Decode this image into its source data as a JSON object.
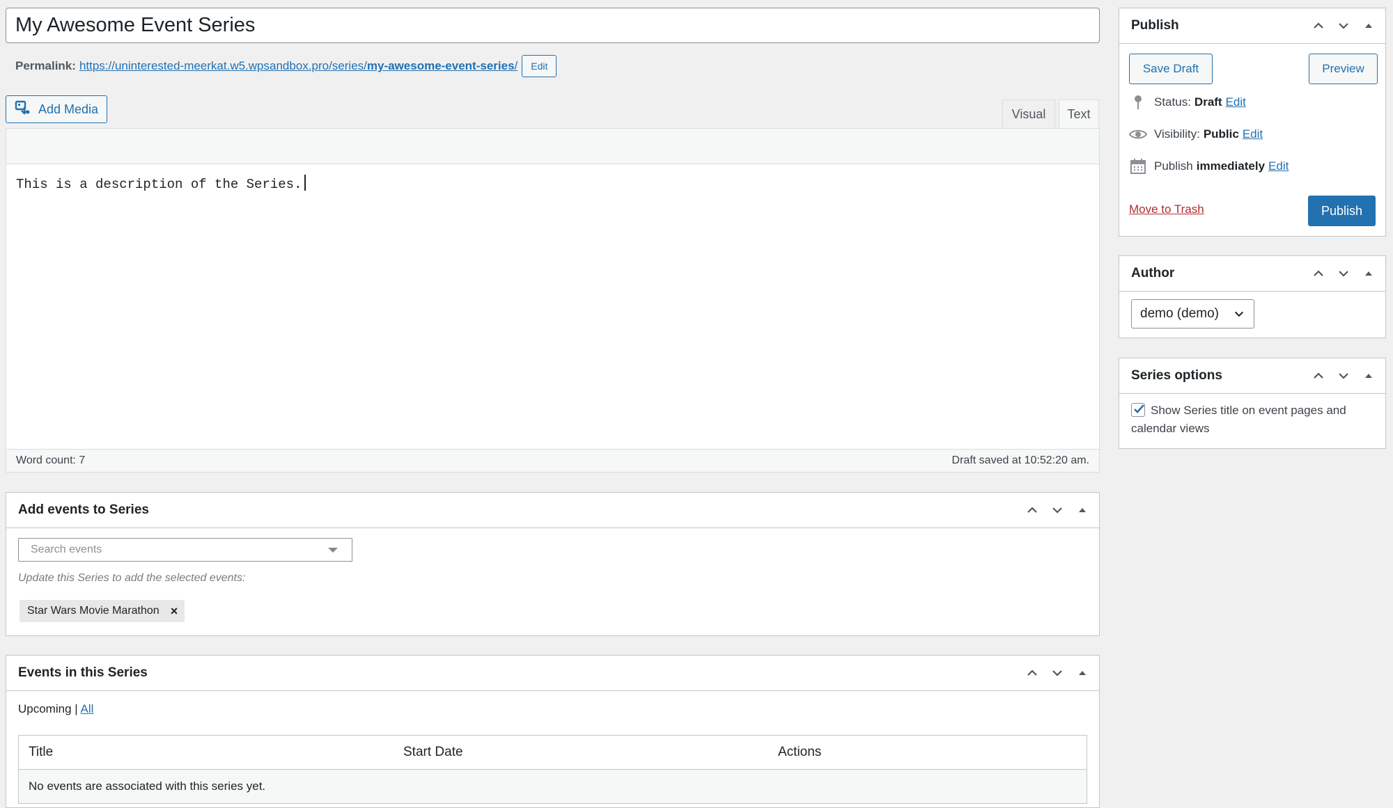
{
  "post": {
    "title": "My Awesome Event Series",
    "permalink_label": "Permalink:",
    "permalink_base": "https://uninterested-meerkat.w5.wpsandbox.pro/series/",
    "permalink_slug": "my-awesome-event-series",
    "permalink_trail": "/",
    "permalink_edit": "Edit"
  },
  "editor": {
    "add_media": "Add Media",
    "tabs": [
      "Visual",
      "Text"
    ],
    "active_tab": "Text",
    "content": "This is a description of the Series.",
    "word_count": "Word count: 7",
    "draft_saved": "Draft saved at 10:52:20 am."
  },
  "add_events": {
    "title": "Add events to Series",
    "search_placeholder": "Search events",
    "note": "Update this Series to add the selected events:",
    "selected": [
      "Star Wars Movie Marathon"
    ],
    "remove_glyph": "×"
  },
  "series_events": {
    "title": "Events in this Series",
    "filter_current": "Upcoming",
    "filter_sep": " | ",
    "filter_all": "All",
    "columns": [
      "Title",
      "Start Date",
      "Actions"
    ],
    "empty": "No events are associated with this series yet."
  },
  "publish": {
    "title": "Publish",
    "save_draft": "Save Draft",
    "preview": "Preview",
    "status_label": "Status:",
    "status_value": "Draft",
    "visibility_label": "Visibility:",
    "visibility_value": "Public",
    "publish_label": "Publish",
    "publish_value": "immediately",
    "edit": "Edit",
    "move_to_trash": "Move to Trash",
    "publish_button": "Publish"
  },
  "author": {
    "title": "Author",
    "selected": "demo (demo)"
  },
  "series_options": {
    "title": "Series options",
    "show_title_label": "Show Series title on event pages and calendar views",
    "show_title_checked": true
  },
  "colors": {
    "accent": "#2271b1",
    "danger": "#b32d2e",
    "background": "#f0f0f1"
  }
}
